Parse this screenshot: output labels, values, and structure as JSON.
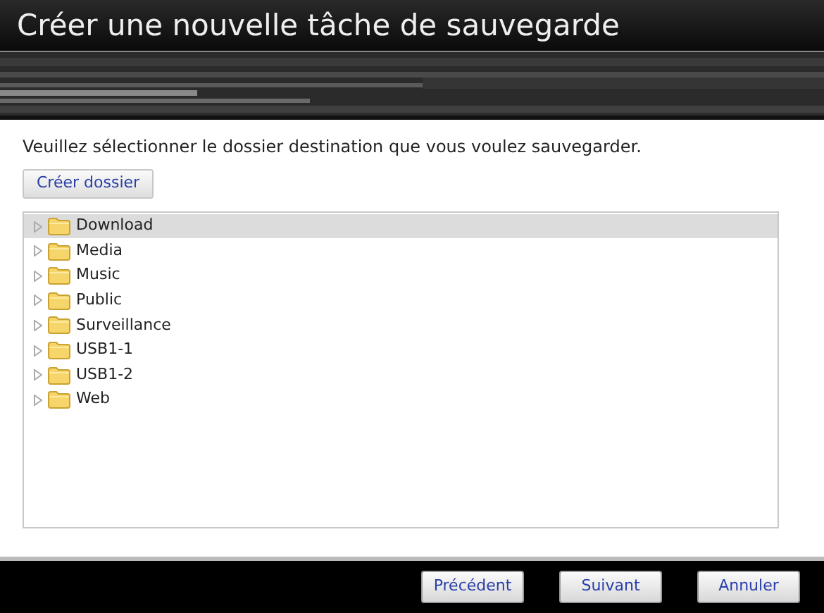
{
  "window": {
    "title": "Créer une nouvelle tâche de sauvegarde"
  },
  "instruction": "Veuillez sélectionner le dossier destination que vous voulez sauvegarder.",
  "create_folder_button": "Créer dossier",
  "tree": {
    "items": [
      {
        "label": "Download",
        "selected": true
      },
      {
        "label": "Media",
        "selected": false
      },
      {
        "label": "Music",
        "selected": false
      },
      {
        "label": "Public",
        "selected": false
      },
      {
        "label": "Surveillance",
        "selected": false
      },
      {
        "label": "USB1-1",
        "selected": false
      },
      {
        "label": "USB1-2",
        "selected": false
      },
      {
        "label": "Web",
        "selected": false
      }
    ]
  },
  "buttons": [
    "Précédent",
    "Suivant",
    "Annuler"
  ]
}
